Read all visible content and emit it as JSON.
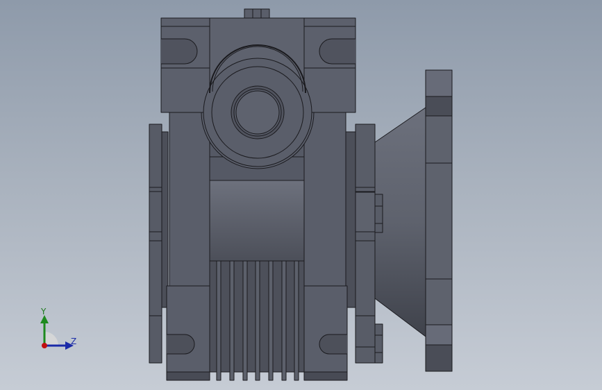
{
  "triad": {
    "y_label": "Y",
    "z_label": "Z",
    "colors": {
      "y": "#1e8a1e",
      "z": "#1a2aa8",
      "x": "#c01010"
    }
  },
  "model": {
    "colors": {
      "face": "#5a5e6a",
      "face_light": "#676b78",
      "face_dark": "#4a4d57",
      "edge": "#1a1a1e"
    }
  }
}
